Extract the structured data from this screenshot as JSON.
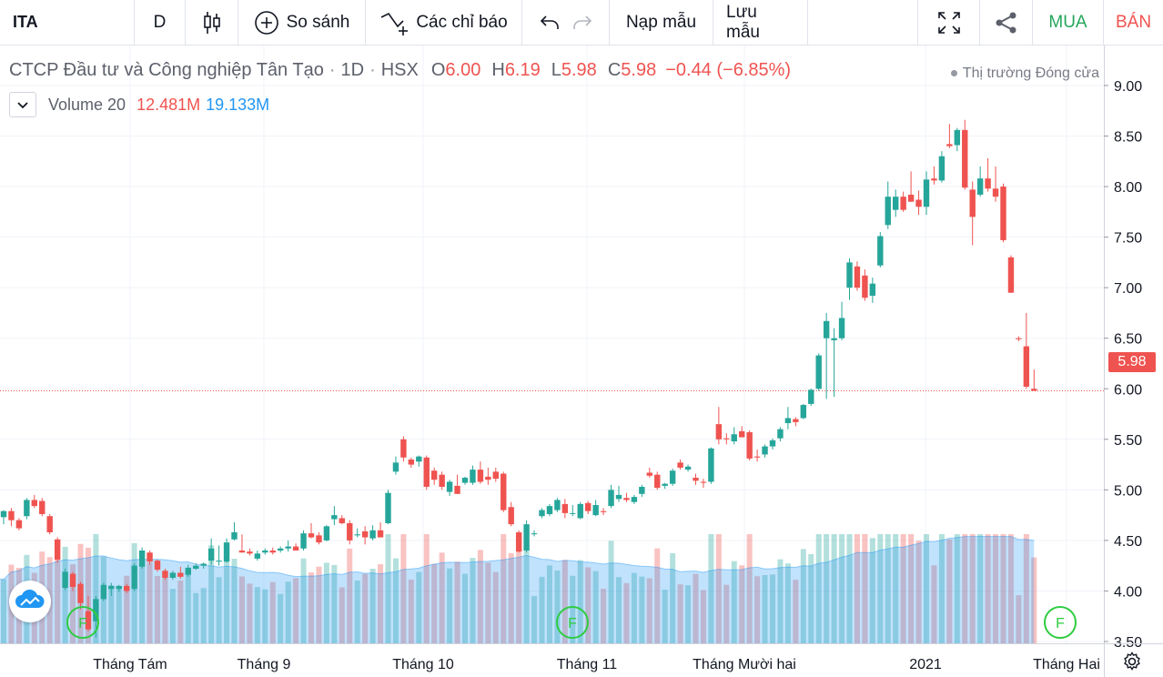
{
  "toolbar": {
    "symbol": "ITA",
    "interval": "D",
    "compare_label": "So sánh",
    "indicators_label": "Các chỉ báo",
    "load_label": "Nạp mẫu",
    "save_label": "Lưu mẫu",
    "buy_label": "MUA",
    "sell_label": "BÁN"
  },
  "legend": {
    "company": "CTCP Đầu tư và Công nghiệp Tân Tạo",
    "interval": "1D",
    "exchange": "HSX",
    "o_label": "O",
    "o_value": "6.00",
    "h_label": "H",
    "h_value": "6.19",
    "l_label": "L",
    "l_value": "5.98",
    "c_label": "C",
    "c_value": "5.98",
    "change": "−0.44 (−6.85%)",
    "market_status": "Thị trường Đóng cửa"
  },
  "volume_legend": {
    "name": "Volume 20",
    "value": "12.481M",
    "ma_value": "19.133M"
  },
  "colors": {
    "up": "#26a69a",
    "down": "#ef5350",
    "volume_up": "rgba(38,166,154,0.35)",
    "volume_down": "rgba(239,83,80,0.35)",
    "volume_ma": "#2196f3"
  },
  "chart_data": {
    "type": "candlestick",
    "y_ticks": [
      "9.00",
      "8.50",
      "8.00",
      "7.50",
      "7.00",
      "6.50",
      "6.00",
      "5.50",
      "5.00",
      "4.50",
      "4.00",
      "3.50"
    ],
    "ylim": [
      3.3,
      9.05
    ],
    "x_ticks": [
      "Tháng Tám",
      "Tháng 9",
      "Tháng 10",
      "Tháng 11",
      "Tháng Mười hai",
      "2021",
      "Tháng Hai"
    ],
    "last_price": "5.98",
    "grid": true,
    "dividend_markers": [
      "F",
      "F",
      "F"
    ],
    "candles": [
      {
        "o": 4.73,
        "h": 4.8,
        "l": 4.66,
        "c": 4.79
      },
      {
        "o": 4.79,
        "h": 4.82,
        "l": 4.64,
        "c": 4.7
      },
      {
        "o": 4.7,
        "h": 4.72,
        "l": 4.6,
        "c": 4.62
      },
      {
        "o": 4.74,
        "h": 4.92,
        "l": 4.71,
        "c": 4.9
      },
      {
        "o": 4.9,
        "h": 4.95,
        "l": 4.82,
        "c": 4.84
      },
      {
        "o": 4.89,
        "h": 4.92,
        "l": 4.74,
        "c": 4.76
      },
      {
        "o": 4.74,
        "h": 4.76,
        "l": 4.56,
        "c": 4.58
      },
      {
        "o": 4.51,
        "h": 4.53,
        "l": 4.28,
        "c": 4.31
      },
      {
        "o": 4.03,
        "h": 4.22,
        "l": 4.01,
        "c": 4.19
      },
      {
        "o": 4.17,
        "h": 4.19,
        "l": 4.0,
        "c": 4.04
      },
      {
        "o": 4.07,
        "h": 4.09,
        "l": 3.82,
        "c": 3.88
      },
      {
        "o": 3.8,
        "h": 3.95,
        "l": 3.6,
        "c": 3.62
      },
      {
        "o": 3.7,
        "h": 3.95,
        "l": 3.54,
        "c": 3.92
      },
      {
        "o": 3.92,
        "h": 4.08,
        "l": 3.9,
        "c": 4.06
      },
      {
        "o": 4.02,
        "h": 4.08,
        "l": 3.95,
        "c": 4.05
      },
      {
        "o": 4.02,
        "h": 4.06,
        "l": 3.99,
        "c": 4.05
      },
      {
        "o": 4.05,
        "h": 4.07,
        "l": 3.98,
        "c": 4.0
      },
      {
        "o": 4.02,
        "h": 4.27,
        "l": 4.0,
        "c": 4.25
      },
      {
        "o": 4.24,
        "h": 4.43,
        "l": 4.22,
        "c": 4.4
      },
      {
        "o": 4.38,
        "h": 4.4,
        "l": 4.26,
        "c": 4.29
      },
      {
        "o": 4.3,
        "h": 4.31,
        "l": 4.19,
        "c": 4.21
      },
      {
        "o": 4.2,
        "h": 4.22,
        "l": 4.11,
        "c": 4.13
      },
      {
        "o": 4.13,
        "h": 4.2,
        "l": 4.11,
        "c": 4.18
      },
      {
        "o": 4.18,
        "h": 4.24,
        "l": 4.12,
        "c": 4.14
      },
      {
        "o": 4.16,
        "h": 4.26,
        "l": 4.14,
        "c": 4.23
      },
      {
        "o": 4.22,
        "h": 4.27,
        "l": 4.21,
        "c": 4.25
      },
      {
        "o": 4.25,
        "h": 4.28,
        "l": 4.22,
        "c": 4.27
      },
      {
        "o": 4.3,
        "h": 4.52,
        "l": 4.26,
        "c": 4.42
      },
      {
        "o": 4.29,
        "h": 4.45,
        "l": 4.25,
        "c": 4.3
      },
      {
        "o": 4.29,
        "h": 4.52,
        "l": 4.28,
        "c": 4.48
      },
      {
        "o": 4.51,
        "h": 4.68,
        "l": 4.5,
        "c": 4.58
      },
      {
        "o": 4.4,
        "h": 4.56,
        "l": 4.38,
        "c": 4.38
      },
      {
        "o": 4.39,
        "h": 4.42,
        "l": 4.35,
        "c": 4.37
      },
      {
        "o": 4.32,
        "h": 4.4,
        "l": 4.3,
        "c": 4.37
      },
      {
        "o": 4.38,
        "h": 4.42,
        "l": 4.36,
        "c": 4.4
      },
      {
        "o": 4.4,
        "h": 4.43,
        "l": 4.36,
        "c": 4.38
      },
      {
        "o": 4.4,
        "h": 4.44,
        "l": 4.38,
        "c": 4.42
      },
      {
        "o": 4.42,
        "h": 4.5,
        "l": 4.39,
        "c": 4.44
      },
      {
        "o": 4.44,
        "h": 4.47,
        "l": 4.4,
        "c": 4.4
      },
      {
        "o": 4.42,
        "h": 4.6,
        "l": 4.4,
        "c": 4.57
      },
      {
        "o": 4.57,
        "h": 4.67,
        "l": 4.52,
        "c": 4.53
      },
      {
        "o": 4.55,
        "h": 4.58,
        "l": 4.46,
        "c": 4.48
      },
      {
        "o": 4.5,
        "h": 4.65,
        "l": 4.49,
        "c": 4.64
      },
      {
        "o": 4.71,
        "h": 4.84,
        "l": 4.65,
        "c": 4.75
      },
      {
        "o": 4.72,
        "h": 4.75,
        "l": 4.66,
        "c": 4.67
      },
      {
        "o": 4.67,
        "h": 4.7,
        "l": 4.46,
        "c": 4.5
      },
      {
        "o": 4.55,
        "h": 4.62,
        "l": 4.53,
        "c": 4.56
      },
      {
        "o": 4.59,
        "h": 4.64,
        "l": 4.46,
        "c": 4.53
      },
      {
        "o": 4.52,
        "h": 4.65,
        "l": 4.5,
        "c": 4.6
      },
      {
        "o": 4.6,
        "h": 4.68,
        "l": 4.53,
        "c": 4.53
      },
      {
        "o": 4.67,
        "h": 5.0,
        "l": 4.66,
        "c": 4.97
      },
      {
        "o": 5.18,
        "h": 5.33,
        "l": 5.15,
        "c": 5.27
      },
      {
        "o": 5.5,
        "h": 5.53,
        "l": 5.28,
        "c": 5.32
      },
      {
        "o": 5.3,
        "h": 5.32,
        "l": 5.22,
        "c": 5.25
      },
      {
        "o": 5.28,
        "h": 5.34,
        "l": 5.23,
        "c": 5.33
      },
      {
        "o": 5.32,
        "h": 5.34,
        "l": 5.0,
        "c": 5.03
      },
      {
        "o": 5.19,
        "h": 5.22,
        "l": 5.05,
        "c": 5.1
      },
      {
        "o": 5.15,
        "h": 5.18,
        "l": 5.0,
        "c": 5.03
      },
      {
        "o": 4.98,
        "h": 5.1,
        "l": 4.94,
        "c": 5.08
      },
      {
        "o": 5.04,
        "h": 5.15,
        "l": 4.96,
        "c": 4.96
      },
      {
        "o": 5.07,
        "h": 5.13,
        "l": 5.05,
        "c": 5.12
      },
      {
        "o": 5.07,
        "h": 5.24,
        "l": 5.05,
        "c": 5.2
      },
      {
        "o": 5.2,
        "h": 5.28,
        "l": 5.06,
        "c": 5.08
      },
      {
        "o": 5.13,
        "h": 5.22,
        "l": 5.05,
        "c": 5.1
      },
      {
        "o": 5.18,
        "h": 5.22,
        "l": 5.08,
        "c": 5.11
      },
      {
        "o": 5.16,
        "h": 5.18,
        "l": 4.78,
        "c": 4.8
      },
      {
        "o": 4.83,
        "h": 4.88,
        "l": 4.64,
        "c": 4.66
      },
      {
        "o": 4.58,
        "h": 4.6,
        "l": 4.38,
        "c": 4.39
      },
      {
        "o": 4.4,
        "h": 4.7,
        "l": 4.38,
        "c": 4.66
      },
      {
        "o": 4.57,
        "h": 4.6,
        "l": 4.54,
        "c": 4.57
      },
      {
        "o": 4.74,
        "h": 4.82,
        "l": 4.72,
        "c": 4.8
      },
      {
        "o": 4.76,
        "h": 4.86,
        "l": 4.74,
        "c": 4.84
      },
      {
        "o": 4.8,
        "h": 4.92,
        "l": 4.78,
        "c": 4.9
      },
      {
        "o": 4.86,
        "h": 4.91,
        "l": 4.72,
        "c": 4.77
      },
      {
        "o": 4.77,
        "h": 4.85,
        "l": 4.74,
        "c": 4.77
      },
      {
        "o": 4.72,
        "h": 4.88,
        "l": 4.71,
        "c": 4.86
      },
      {
        "o": 4.87,
        "h": 4.89,
        "l": 4.76,
        "c": 4.79
      },
      {
        "o": 4.75,
        "h": 4.9,
        "l": 4.74,
        "c": 4.85
      },
      {
        "o": 4.79,
        "h": 4.82,
        "l": 4.75,
        "c": 4.78
      },
      {
        "o": 4.84,
        "h": 5.05,
        "l": 4.82,
        "c": 5.0
      },
      {
        "o": 4.91,
        "h": 5.04,
        "l": 4.88,
        "c": 4.95
      },
      {
        "o": 4.92,
        "h": 4.97,
        "l": 4.88,
        "c": 4.9
      },
      {
        "o": 4.88,
        "h": 4.95,
        "l": 4.86,
        "c": 4.93
      },
      {
        "o": 4.96,
        "h": 5.05,
        "l": 4.93,
        "c": 5.03
      },
      {
        "o": 5.17,
        "h": 5.22,
        "l": 5.12,
        "c": 5.14
      },
      {
        "o": 5.15,
        "h": 5.18,
        "l": 5.0,
        "c": 5.02
      },
      {
        "o": 5.04,
        "h": 5.07,
        "l": 5.01,
        "c": 5.06
      },
      {
        "o": 5.06,
        "h": 5.21,
        "l": 5.04,
        "c": 5.19
      },
      {
        "o": 5.27,
        "h": 5.3,
        "l": 5.2,
        "c": 5.22
      },
      {
        "o": 5.2,
        "h": 5.25,
        "l": 5.18,
        "c": 5.23
      },
      {
        "o": 5.12,
        "h": 5.16,
        "l": 5.05,
        "c": 5.09
      },
      {
        "o": 5.08,
        "h": 5.11,
        "l": 5.02,
        "c": 5.07
      },
      {
        "o": 5.08,
        "h": 5.42,
        "l": 5.06,
        "c": 5.41
      },
      {
        "o": 5.65,
        "h": 5.82,
        "l": 5.45,
        "c": 5.5
      },
      {
        "o": 5.51,
        "h": 5.56,
        "l": 5.45,
        "c": 5.5
      },
      {
        "o": 5.48,
        "h": 5.62,
        "l": 5.45,
        "c": 5.55
      },
      {
        "o": 5.58,
        "h": 5.63,
        "l": 5.52,
        "c": 5.52
      },
      {
        "o": 5.57,
        "h": 5.59,
        "l": 5.29,
        "c": 5.31
      },
      {
        "o": 5.33,
        "h": 5.4,
        "l": 5.28,
        "c": 5.32
      },
      {
        "o": 5.35,
        "h": 5.45,
        "l": 5.32,
        "c": 5.43
      },
      {
        "o": 5.43,
        "h": 5.51,
        "l": 5.4,
        "c": 5.49
      },
      {
        "o": 5.51,
        "h": 5.62,
        "l": 5.48,
        "c": 5.6
      },
      {
        "o": 5.66,
        "h": 5.82,
        "l": 5.6,
        "c": 5.71
      },
      {
        "o": 5.7,
        "h": 5.72,
        "l": 5.63,
        "c": 5.67
      },
      {
        "o": 5.71,
        "h": 5.85,
        "l": 5.7,
        "c": 5.84
      },
      {
        "o": 5.85,
        "h": 6.0,
        "l": 5.83,
        "c": 5.99
      },
      {
        "o": 6.0,
        "h": 6.35,
        "l": 5.98,
        "c": 6.33
      },
      {
        "o": 6.5,
        "h": 6.75,
        "l": 5.9,
        "c": 6.67
      },
      {
        "o": 6.48,
        "h": 6.6,
        "l": 5.92,
        "c": 6.5
      },
      {
        "o": 6.5,
        "h": 6.86,
        "l": 6.48,
        "c": 6.7
      },
      {
        "o": 7.0,
        "h": 7.29,
        "l": 6.88,
        "c": 7.25
      },
      {
        "o": 7.21,
        "h": 7.26,
        "l": 6.97,
        "c": 7.0
      },
      {
        "o": 7.12,
        "h": 7.18,
        "l": 6.87,
        "c": 6.9
      },
      {
        "o": 6.92,
        "h": 7.1,
        "l": 6.85,
        "c": 7.04
      },
      {
        "o": 7.22,
        "h": 7.55,
        "l": 7.2,
        "c": 7.51
      },
      {
        "o": 7.62,
        "h": 8.05,
        "l": 7.58,
        "c": 7.9
      },
      {
        "o": 7.77,
        "h": 7.97,
        "l": 7.7,
        "c": 7.9
      },
      {
        "o": 7.9,
        "h": 7.95,
        "l": 7.75,
        "c": 7.77
      },
      {
        "o": 7.92,
        "h": 8.15,
        "l": 7.85,
        "c": 7.85
      },
      {
        "o": 7.87,
        "h": 7.96,
        "l": 7.72,
        "c": 7.8
      },
      {
        "o": 7.8,
        "h": 8.15,
        "l": 7.72,
        "c": 8.07
      },
      {
        "o": 8.08,
        "h": 8.2,
        "l": 8.02,
        "c": 8.06
      },
      {
        "o": 8.06,
        "h": 8.35,
        "l": 8.04,
        "c": 8.3
      },
      {
        "o": 8.42,
        "h": 8.62,
        "l": 8.38,
        "c": 8.4
      },
      {
        "o": 8.41,
        "h": 8.58,
        "l": 8.35,
        "c": 8.56
      },
      {
        "o": 8.56,
        "h": 8.66,
        "l": 7.97,
        "c": 7.99
      },
      {
        "o": 7.97,
        "h": 8.05,
        "l": 7.42,
        "c": 7.7
      },
      {
        "o": 7.92,
        "h": 8.2,
        "l": 7.9,
        "c": 8.08
      },
      {
        "o": 8.08,
        "h": 8.28,
        "l": 7.95,
        "c": 7.98
      },
      {
        "o": 7.98,
        "h": 8.2,
        "l": 7.85,
        "c": 7.9
      },
      {
        "o": 8.0,
        "h": 8.03,
        "l": 7.45,
        "c": 7.47
      },
      {
        "o": 7.3,
        "h": 7.32,
        "l": 6.95,
        "c": 6.95
      },
      {
        "o": 6.5,
        "h": 6.52,
        "l": 6.47,
        "c": 6.49
      },
      {
        "o": 6.42,
        "h": 6.75,
        "l": 6.0,
        "c": 6.02
      },
      {
        "o": 6.0,
        "h": 6.19,
        "l": 5.98,
        "c": 5.98
      }
    ]
  }
}
